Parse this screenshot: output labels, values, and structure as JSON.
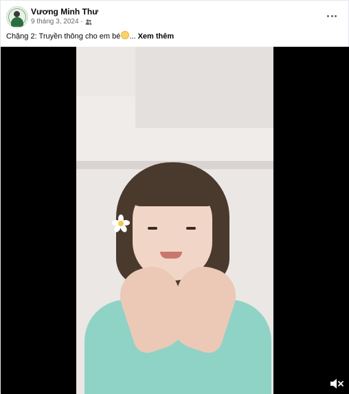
{
  "post": {
    "author_name": "Vương Minh Thư",
    "date": "9 tháng 3, 2024",
    "separator": "·",
    "audience_icon": "friends-icon",
    "more_icon": "more-horizontal-icon",
    "caption_text": "Chặng 2: Truyền thông cho em bé",
    "caption_emoji": "smiling-face-emoji",
    "caption_ellipsis": "...",
    "see_more_label": "Xem thêm"
  },
  "video": {
    "sound_icon": "volume-muted-icon"
  },
  "colors": {
    "text_primary": "#050505",
    "text_secondary": "#65676b",
    "video_background": "#000000"
  }
}
